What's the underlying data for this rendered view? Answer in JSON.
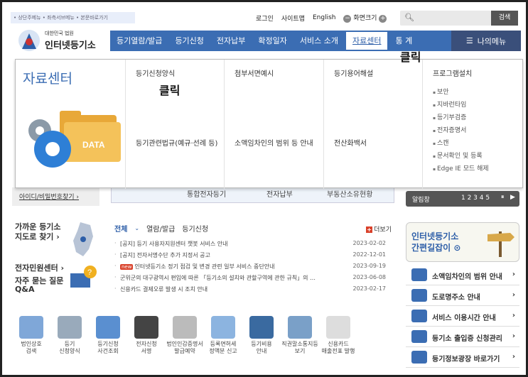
{
  "skip_links": "• 상단주메뉴 • 좌측서브메뉴 • 본문바로가기",
  "util": {
    "login": "로그인",
    "sitemap": "사이트맵",
    "english": "English",
    "zoom_label": "화면크기",
    "minus": "−",
    "plus": "+"
  },
  "search": {
    "placeholder": "",
    "button": "검색",
    "icon": "search-icon"
  },
  "logo": {
    "sub": "대한민국 법원",
    "main": "인터넷등기소"
  },
  "gnb": [
    {
      "label": "등기열람/발급"
    },
    {
      "label": "등기신청"
    },
    {
      "label": "전자납부"
    },
    {
      "label": "확정일자"
    },
    {
      "label": "서비스 소개"
    },
    {
      "label": "자료센터"
    },
    {
      "label": "통 계"
    }
  ],
  "my_menu": "나의메뉴",
  "annotations": {
    "click1": "클릭",
    "click2": "클릭"
  },
  "mega": {
    "title": "자료센터",
    "col1": {
      "link1": "등기신청양식",
      "link2": "등기관련법규(예규·선례 등)"
    },
    "col2": {
      "link1": "첨부서면예시",
      "link2": "소액임차인의 범위 등 안내"
    },
    "col3": {
      "link1": "등기용어해설",
      "link2": "전산화백서"
    },
    "col4": {
      "title": "프로그램설치",
      "items": [
        "보안",
        "지바런타임",
        "등기부검증",
        "전자증명서",
        "스캔",
        "문서확인 및 등록",
        "Edge IE 모드 해제"
      ]
    },
    "folder_text": "DATA"
  },
  "strip": {
    "a": "통합전자등기",
    "b": "전자납부",
    "c": "부동산소유현황"
  },
  "id_find": "아이디/비밀번호찾기 ›",
  "alim": {
    "label": "알림창",
    "pages": "1  2  3  4  5"
  },
  "left": {
    "map1": "가까운 등기소",
    "map2": "지도로 찾기 ›",
    "civil": "전자민원센터 ›",
    "faq1": "자주 묻는 질문",
    "faq2": "Q&A"
  },
  "notice": {
    "tabs": [
      "전체",
      "열람/발급",
      "등기신청"
    ],
    "more": "더보기",
    "items": [
      {
        "title": "[공지] 등기 사용자지원센터 챗봇 서비스 안내",
        "date": "2023-02-02",
        "new": ""
      },
      {
        "title": "[공지] 전자서명수단 추가 지정서 공고",
        "date": "2022-12-01",
        "new": ""
      },
      {
        "title": "인터넷등기소 정기 점검 및 변경 관련 일부 서비스 중단안내",
        "date": "2023-09-19",
        "new": "new"
      },
      {
        "title": "군위군의 대구광역시 편입에 따른 「등기소의 설치와 관할구역에 관한 규칙」의 …",
        "date": "2023-06-08",
        "new": ""
      },
      {
        "title": "신용카드 결제오류 발생 시 조치 안내",
        "date": "2023-02-17",
        "new": ""
      }
    ]
  },
  "banner": {
    "l1": "인터넷등기소",
    "l2": "간편길잡이 ⊙"
  },
  "quick": [
    {
      "label": "소액임차인의 범위 안내",
      "icon": "house-icon"
    },
    {
      "label": "도로명주소 안내",
      "icon": "road-sign-icon"
    },
    {
      "label": "서비스 이용시간 안내",
      "icon": "clock-icon"
    },
    {
      "label": "등기소 출입증 신청관리",
      "icon": "id-card-icon"
    },
    {
      "label": "등기정보광장 바로가기",
      "icon": "chart-icon"
    }
  ],
  "services": [
    {
      "label": "법인상호\n검색",
      "icon": "magnifier-icon",
      "color": "#7fa7d8"
    },
    {
      "label": "등기\n신청양식",
      "icon": "form-icon",
      "color": "#9ab"
    },
    {
      "label": "등기신청\n사건조회",
      "icon": "monitor-icon",
      "color": "#5a8fd0"
    },
    {
      "label": "전자신청\n서명",
      "icon": "pen-icon",
      "color": "#444"
    },
    {
      "label": "법인인감증명서\n발급예약",
      "icon": "calendar-icon",
      "color": "#bbb"
    },
    {
      "label": "등록면허세\n정액분 신고",
      "icon": "document-icon",
      "color": "#8cb4e0"
    },
    {
      "label": "등기비용\n안내",
      "icon": "question-icon",
      "color": "#3a6aa0"
    },
    {
      "label": "직권말소통지등\n보기",
      "icon": "chat-icon",
      "color": "#7aa0c8"
    },
    {
      "label": "신용카드\n매출전표 발행",
      "icon": "receipt-icon",
      "color": "#ddd"
    }
  ]
}
